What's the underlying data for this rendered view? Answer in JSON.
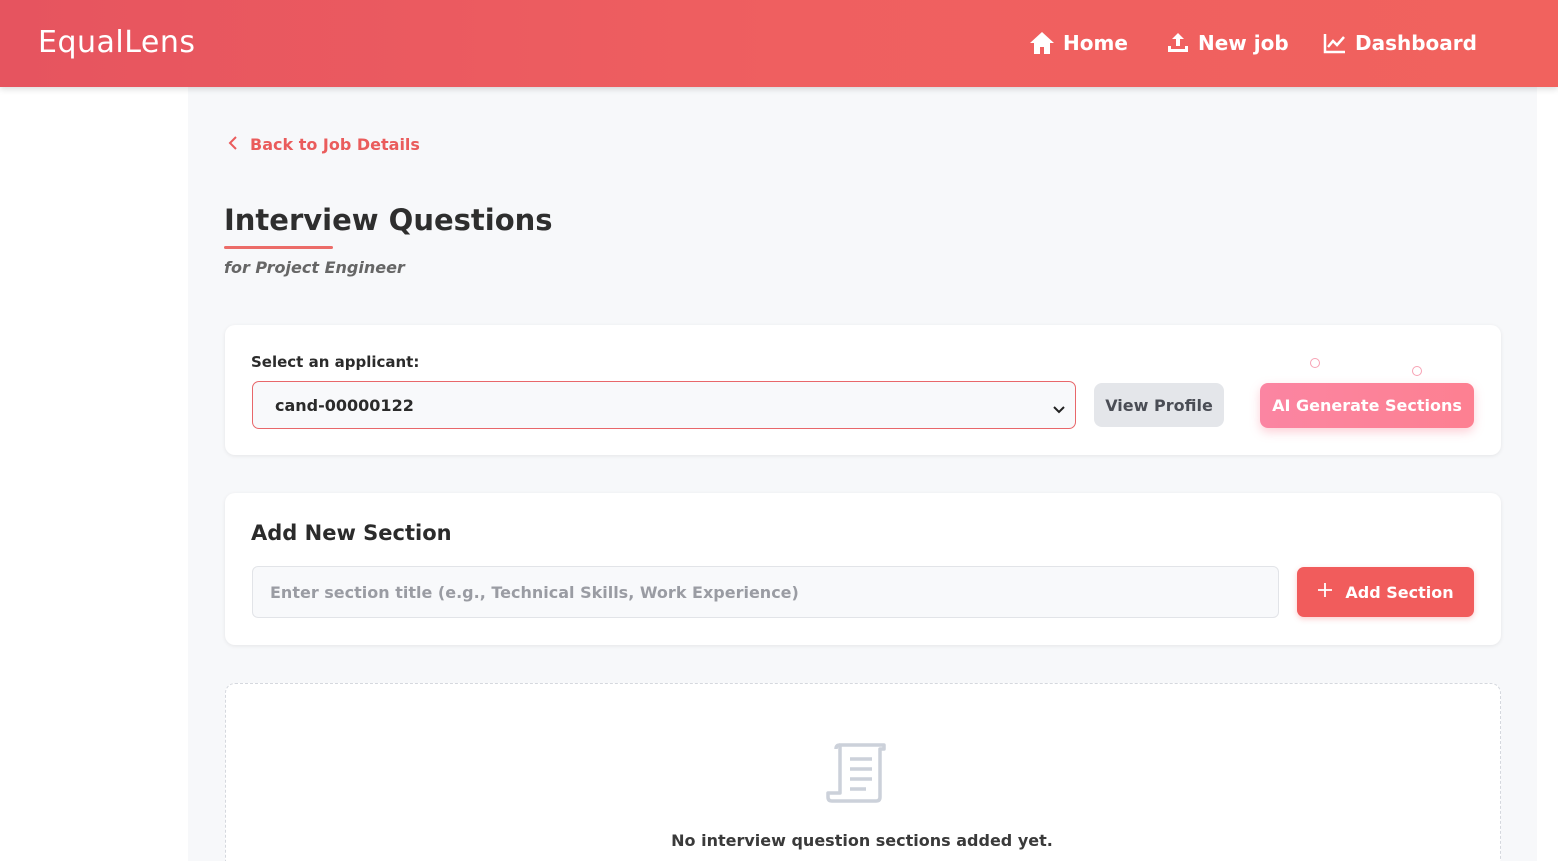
{
  "brand": {
    "name_part1": "Equal",
    "name_part2": "Lens"
  },
  "nav": {
    "home": "Home",
    "new_job": "New job",
    "dashboard": "Dashboard"
  },
  "back_link": "Back to Job Details",
  "page": {
    "title": "Interview Questions",
    "subtitle": "for Project Engineer"
  },
  "applicant": {
    "label": "Select an applicant:",
    "selected": "cand-00000122",
    "view_profile": "View Profile",
    "ai_generate": "AI Generate Sections"
  },
  "add_section": {
    "heading": "Add New Section",
    "placeholder": "Enter section title (e.g., Technical Skills, Work Experience)",
    "value": "",
    "button": "Add Section"
  },
  "empty_state": {
    "message": "No interview question sections added yet."
  },
  "colors": {
    "header_start": "#e6545f",
    "header_end": "#f1625e",
    "accent": "#f15c5c",
    "ai_button": "#fb85a2"
  }
}
